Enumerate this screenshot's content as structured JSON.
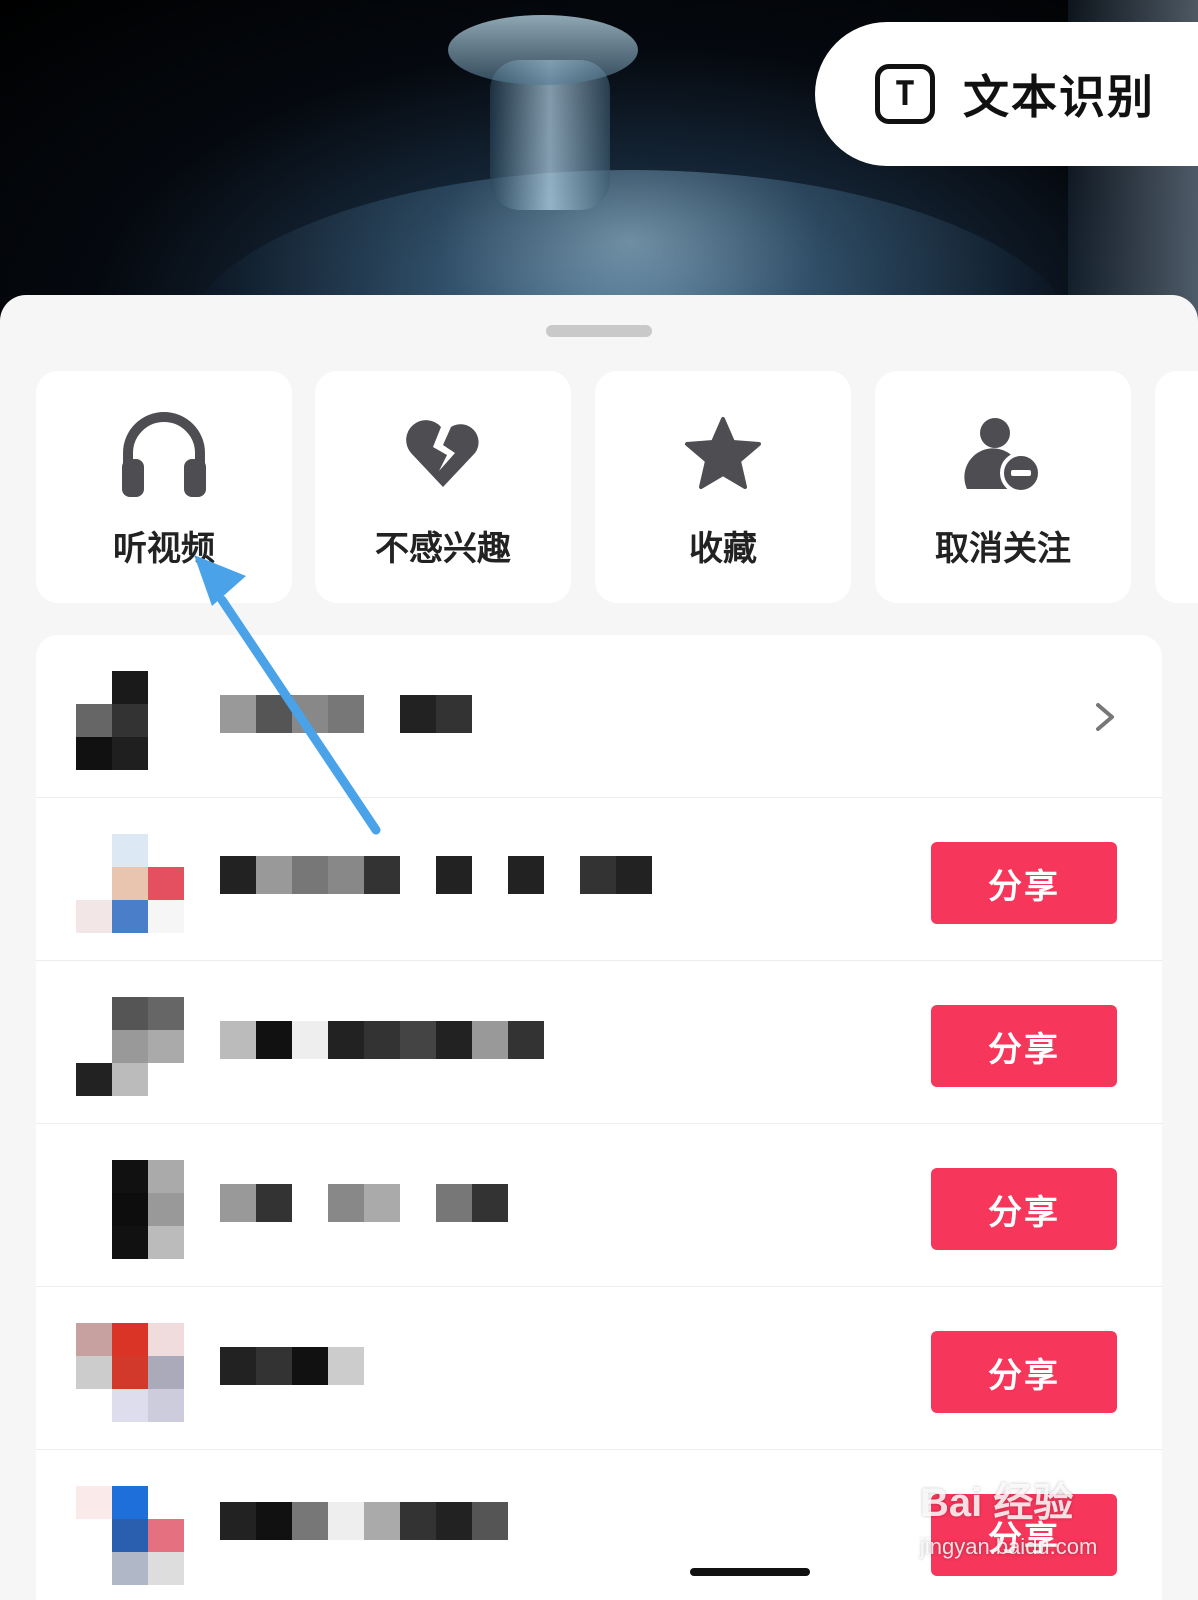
{
  "ocr": {
    "label": "文本识别",
    "icon": "T"
  },
  "actions": [
    {
      "label": "听视频",
      "icon": "headphones-icon"
    },
    {
      "label": "不感兴趣",
      "icon": "broken-heart-icon"
    },
    {
      "label": "收藏",
      "icon": "star-icon"
    },
    {
      "label": "取消关注",
      "icon": "unfollow-user-icon"
    }
  ],
  "share": {
    "button_label": "分享"
  },
  "watermark": {
    "main": "Bai 经验",
    "sub": "jingyan.baidu.com"
  },
  "colors": {
    "share_button": "#f6365a",
    "sheet_bg": "#f6f6f6",
    "icon": "#4d4d52",
    "arrow": "#4aa3e8"
  }
}
